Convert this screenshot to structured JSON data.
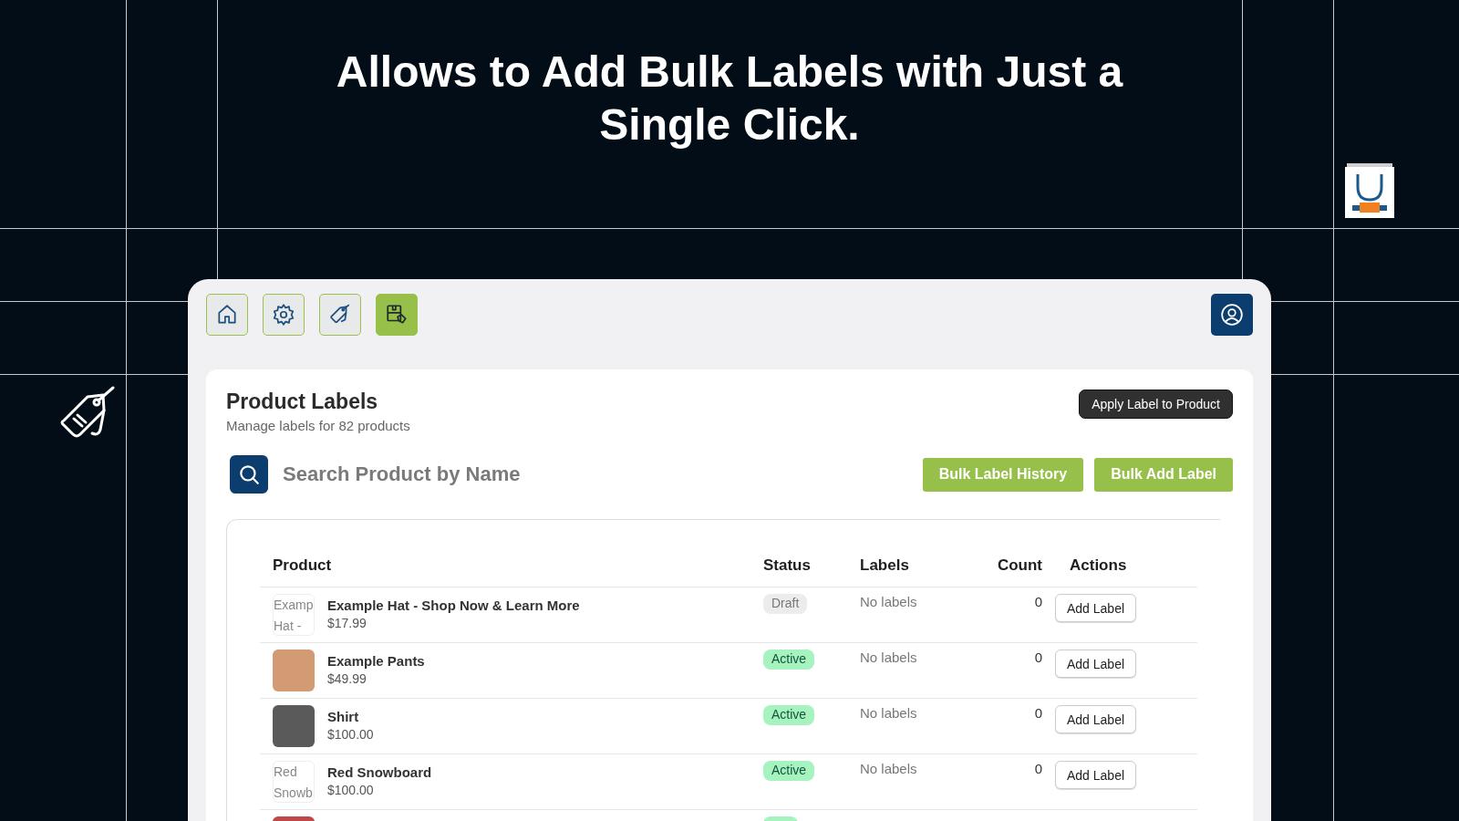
{
  "headline": "Allows to Add Bulk Labels with Just a Single Click.",
  "nav": [
    {
      "selected": false
    },
    {
      "selected": false
    },
    {
      "selected": false
    },
    {
      "selected": true
    }
  ],
  "page": {
    "title": "Product Labels",
    "subtitle": "Manage labels for 82 products",
    "apply_button": "Apply Label to Product"
  },
  "search": {
    "placeholder": "Search Product by Name"
  },
  "buttons": [
    "Bulk Label History",
    "Bulk Add Label"
  ],
  "table": {
    "columns": [
      "Product",
      "Status",
      "Labels",
      "Count",
      "Actions"
    ],
    "rows": [
      {
        "kind": "alt",
        "thumb_text": "Examp Hat -",
        "name": "Example Hat - Shop Now & Learn More",
        "price": "$17.99",
        "status": "Draft",
        "color": "#ececec",
        "labels": "No labels",
        "count": "0",
        "action": "Add Label"
      },
      {
        "kind": "photo",
        "name": "Example Pants",
        "price": "$49.99",
        "status": "Active",
        "color": "#a7f3c0",
        "labels": "No labels",
        "count": "0",
        "action": "Add Label"
      },
      {
        "kind": "photo",
        "name": "Shirt",
        "price": "$100.00",
        "status": "Active",
        "color": "#a7f3c0",
        "labels": "No labels",
        "count": "0",
        "action": "Add Label"
      },
      {
        "kind": "alt",
        "thumb_text": "Red Snowb",
        "name": "Red Snowboard",
        "price": "$100.00",
        "status": "Active",
        "color": "#a7f3c0",
        "labels": "No labels",
        "count": "0",
        "action": "Add Label"
      },
      {
        "kind": "photo",
        "color": "#a7f3c0"
      }
    ]
  }
}
